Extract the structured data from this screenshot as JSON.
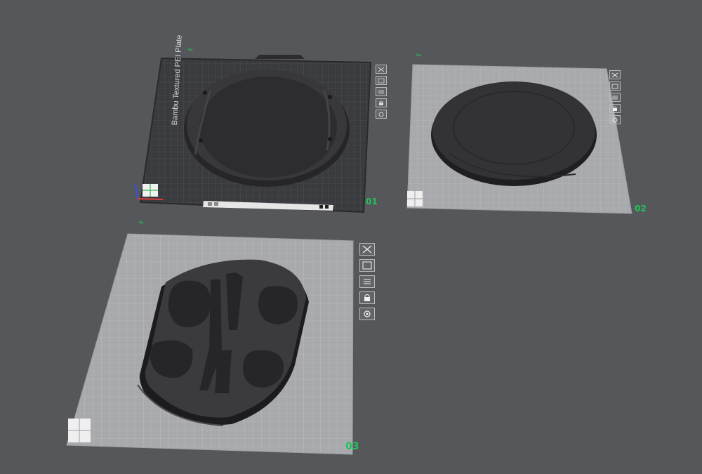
{
  "plates": [
    {
      "number": "01",
      "name": "Bambu Textured PEI Plate",
      "type": "textured-pei"
    },
    {
      "number": "02",
      "name": "",
      "type": "generic"
    },
    {
      "number": "03",
      "name": "",
      "type": "generic"
    }
  ],
  "plate_toolbar_icons": [
    "close-icon",
    "arrange-icon",
    "layout-icon",
    "lock-icon",
    "settings-icon"
  ],
  "colors": {
    "background": "#56575b",
    "plate_number": "#20c45a",
    "textured_plate": "#3a3b3f",
    "generic_plate": "#a8a9ac",
    "model": "#2e2e30"
  }
}
